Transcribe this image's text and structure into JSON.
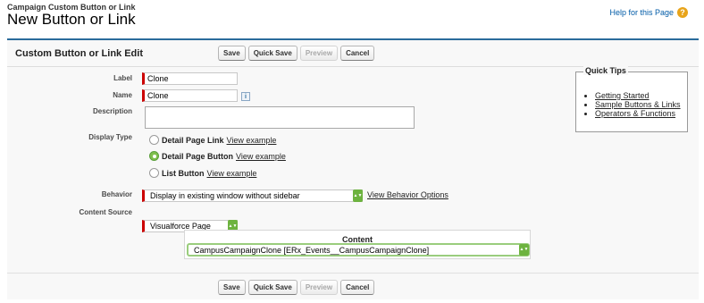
{
  "header": {
    "subtitle": "Campaign Custom Button or Link",
    "title": "New Button or Link",
    "help_link": "Help for this Page",
    "help_icon": "?"
  },
  "panel": {
    "title": "Custom Button or Link Edit",
    "buttons": {
      "save": "Save",
      "quick_save": "Quick Save",
      "preview": "Preview",
      "cancel": "Cancel"
    }
  },
  "form": {
    "label": {
      "label": "Label",
      "value": "Clone"
    },
    "name": {
      "label": "Name",
      "value": "Clone",
      "info_icon": "i"
    },
    "description": {
      "label": "Description",
      "value": ""
    },
    "display_type": {
      "label": "Display Type",
      "options": [
        {
          "label": "Detail Page Link",
          "link": "View example",
          "selected": false
        },
        {
          "label": "Detail Page Button",
          "link": "View example",
          "selected": true
        },
        {
          "label": "List Button",
          "link": "View example",
          "selected": false
        }
      ]
    },
    "behavior": {
      "label": "Behavior",
      "value": "Display in existing window without sidebar",
      "link": "View Behavior Options"
    },
    "content_source": {
      "label": "Content Source",
      "value": "Visualforce Page"
    },
    "content": {
      "header": "Content",
      "value": "CampusCampaignClone [ERx_Events__CampusCampaignClone]"
    }
  },
  "quick_tips": {
    "title": "Quick Tips",
    "items": [
      "Getting Started",
      "Sample Buttons & Links",
      "Operators & Functions"
    ]
  },
  "colors": {
    "accent_border": "#2a6b9b",
    "required_bar": "#cc0000",
    "select_green": "#6db33f",
    "help_icon": "#e8a41a"
  }
}
